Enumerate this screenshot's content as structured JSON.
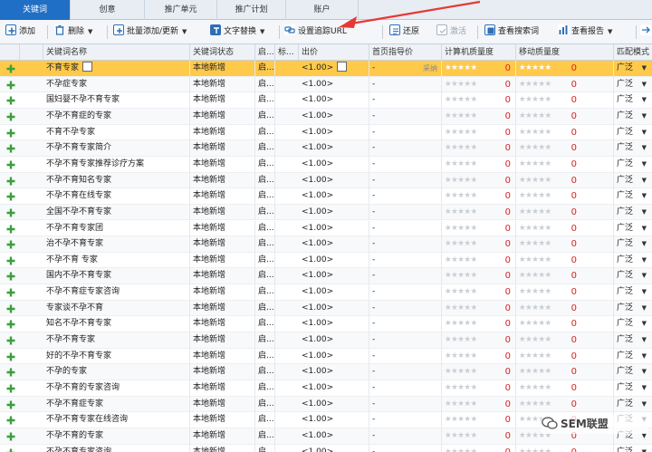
{
  "tabs": [
    {
      "label": "关键词",
      "active": true
    },
    {
      "label": "创意",
      "active": false
    },
    {
      "label": "推广单元",
      "active": false
    },
    {
      "label": "推广计划",
      "active": false
    },
    {
      "label": "账户",
      "active": false
    }
  ],
  "toolbar": {
    "add_label": "添加",
    "delete_label": "删除",
    "bulk_label": "批量添加/更新",
    "replace_label": "文字替换",
    "tracking_label": "设置追踪URL",
    "restore_label": "还原",
    "activate_label": "激活",
    "search_terms_label": "查看搜索词",
    "report_label": "查看报告"
  },
  "columns": {
    "keyword": "关键词名称",
    "status": "关键词状态",
    "enable": "启...",
    "mark": "标...",
    "bid": "出价",
    "guide": "首页指导价",
    "pc_quality": "计算机质量度",
    "mobile_quality": "移动质量度",
    "match": "匹配模式"
  },
  "rows": [
    {
      "keyword": "不育专家",
      "status": "本地新增",
      "enable": "启...",
      "bid": "<1.00>",
      "guide": "-",
      "pc_score": "0",
      "mobile_score": "0",
      "match": "广泛",
      "selected": true,
      "guide_note": "采纳"
    },
    {
      "keyword": "不孕症专家",
      "status": "本地新增",
      "enable": "启...",
      "bid": "<1.00>",
      "guide": "-",
      "pc_score": "0",
      "mobile_score": "0",
      "match": "广泛"
    },
    {
      "keyword": "国妇婴不孕不育专家",
      "status": "本地新增",
      "enable": "启...",
      "bid": "<1.00>",
      "guide": "-",
      "pc_score": "0",
      "mobile_score": "0",
      "match": "广泛"
    },
    {
      "keyword": "不孕不育症的专家",
      "status": "本地新增",
      "enable": "启...",
      "bid": "<1.00>",
      "guide": "-",
      "pc_score": "0",
      "mobile_score": "0",
      "match": "广泛"
    },
    {
      "keyword": "不育不孕专家",
      "status": "本地新增",
      "enable": "启...",
      "bid": "<1.00>",
      "guide": "-",
      "pc_score": "0",
      "mobile_score": "0",
      "match": "广泛"
    },
    {
      "keyword": "不孕不育专家简介",
      "status": "本地新增",
      "enable": "启...",
      "bid": "<1.00>",
      "guide": "-",
      "pc_score": "0",
      "mobile_score": "0",
      "match": "广泛"
    },
    {
      "keyword": "不孕不育专家推荐诊疗方案",
      "status": "本地新增",
      "enable": "启...",
      "bid": "<1.00>",
      "guide": "-",
      "pc_score": "0",
      "mobile_score": "0",
      "match": "广泛"
    },
    {
      "keyword": "不孕不育知名专家",
      "status": "本地新增",
      "enable": "启...",
      "bid": "<1.00>",
      "guide": "-",
      "pc_score": "0",
      "mobile_score": "0",
      "match": "广泛"
    },
    {
      "keyword": "不孕不育在线专家",
      "status": "本地新增",
      "enable": "启...",
      "bid": "<1.00>",
      "guide": "-",
      "pc_score": "0",
      "mobile_score": "0",
      "match": "广泛"
    },
    {
      "keyword": "全国不孕不育专家",
      "status": "本地新增",
      "enable": "启...",
      "bid": "<1.00>",
      "guide": "-",
      "pc_score": "0",
      "mobile_score": "0",
      "match": "广泛"
    },
    {
      "keyword": "不孕不育专家团",
      "status": "本地新增",
      "enable": "启...",
      "bid": "<1.00>",
      "guide": "-",
      "pc_score": "0",
      "mobile_score": "0",
      "match": "广泛"
    },
    {
      "keyword": "治不孕不育专家",
      "status": "本地新增",
      "enable": "启...",
      "bid": "<1.00>",
      "guide": "-",
      "pc_score": "0",
      "mobile_score": "0",
      "match": "广泛"
    },
    {
      "keyword": "不孕不育 专家",
      "status": "本地新增",
      "enable": "启...",
      "bid": "<1.00>",
      "guide": "-",
      "pc_score": "0",
      "mobile_score": "0",
      "match": "广泛"
    },
    {
      "keyword": "国内不孕不育专家",
      "status": "本地新增",
      "enable": "启...",
      "bid": "<1.00>",
      "guide": "-",
      "pc_score": "0",
      "mobile_score": "0",
      "match": "广泛"
    },
    {
      "keyword": "不孕不育症专家咨询",
      "status": "本地新增",
      "enable": "启...",
      "bid": "<1.00>",
      "guide": "-",
      "pc_score": "0",
      "mobile_score": "0",
      "match": "广泛"
    },
    {
      "keyword": "专家谈不孕不育",
      "status": "本地新增",
      "enable": "启...",
      "bid": "<1.00>",
      "guide": "-",
      "pc_score": "0",
      "mobile_score": "0",
      "match": "广泛"
    },
    {
      "keyword": "知名不孕不育专家",
      "status": "本地新增",
      "enable": "启...",
      "bid": "<1.00>",
      "guide": "-",
      "pc_score": "0",
      "mobile_score": "0",
      "match": "广泛"
    },
    {
      "keyword": "不孕不育专家",
      "status": "本地新增",
      "enable": "启...",
      "bid": "<1.00>",
      "guide": "-",
      "pc_score": "0",
      "mobile_score": "0",
      "match": "广泛"
    },
    {
      "keyword": "好的不孕不育专家",
      "status": "本地新增",
      "enable": "启...",
      "bid": "<1.00>",
      "guide": "-",
      "pc_score": "0",
      "mobile_score": "0",
      "match": "广泛"
    },
    {
      "keyword": "不孕的专家",
      "status": "本地新增",
      "enable": "启...",
      "bid": "<1.00>",
      "guide": "-",
      "pc_score": "0",
      "mobile_score": "0",
      "match": "广泛"
    },
    {
      "keyword": "不孕不育的专家咨询",
      "status": "本地新增",
      "enable": "启...",
      "bid": "<1.00>",
      "guide": "-",
      "pc_score": "0",
      "mobile_score": "0",
      "match": "广泛"
    },
    {
      "keyword": "不孕不育症专家",
      "status": "本地新增",
      "enable": "启...",
      "bid": "<1.00>",
      "guide": "-",
      "pc_score": "0",
      "mobile_score": "0",
      "match": "广泛"
    },
    {
      "keyword": "不孕不育专家在线咨询",
      "status": "本地新增",
      "enable": "启...",
      "bid": "<1.00>",
      "guide": "-",
      "pc_score": "0",
      "mobile_score": "0",
      "match": "广泛"
    },
    {
      "keyword": "不孕不育的专家",
      "status": "本地新增",
      "enable": "启...",
      "bid": "<1.00>",
      "guide": "-",
      "pc_score": "0",
      "mobile_score": "0",
      "match": "广泛"
    },
    {
      "keyword": "不孕不育专家咨询",
      "status": "本地新增",
      "enable": "启...",
      "bid": "<1.00>",
      "guide": "-",
      "pc_score": "0",
      "mobile_score": "0",
      "match": "广泛"
    }
  ],
  "watermark": "SEM联盟",
  "colors": {
    "accent": "#1f6fc6",
    "selected_row": "#ffc94a",
    "score": "#e01e1e",
    "plus": "#3aa03a",
    "arrow": "#e53935"
  }
}
